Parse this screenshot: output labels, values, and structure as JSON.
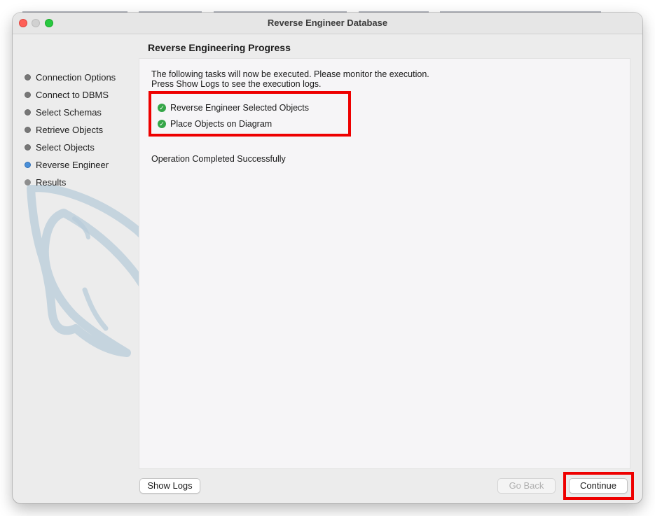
{
  "window": {
    "title": "Reverse Engineer Database"
  },
  "sidebar": {
    "steps": [
      {
        "label": "Connection Options",
        "state": "done"
      },
      {
        "label": "Connect to DBMS",
        "state": "done"
      },
      {
        "label": "Select Schemas",
        "state": "done"
      },
      {
        "label": "Retrieve Objects",
        "state": "done"
      },
      {
        "label": "Select Objects",
        "state": "done"
      },
      {
        "label": "Reverse Engineer",
        "state": "active"
      },
      {
        "label": "Results",
        "state": "pending"
      }
    ]
  },
  "main": {
    "title": "Reverse Engineering Progress",
    "description_line1": "The following tasks will now be executed. Please monitor the execution.",
    "description_line2": "Press Show Logs to see the execution logs.",
    "tasks": [
      {
        "label": "Reverse Engineer Selected Objects",
        "status": "completed",
        "icon": "check-circle-icon"
      },
      {
        "label": "Place Objects on Diagram",
        "status": "completed",
        "icon": "check-circle-icon"
      }
    ],
    "status_message": "Operation Completed Successfully"
  },
  "buttons": {
    "show_logs": "Show Logs",
    "go_back": "Go Back",
    "continue": "Continue"
  },
  "colors": {
    "highlight": "#ee0000",
    "success": "#35a648",
    "active_step": "#4a8fd8"
  }
}
